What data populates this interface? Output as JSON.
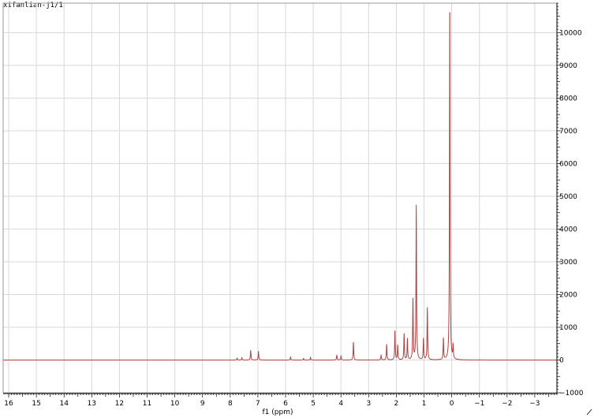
{
  "chart_data": {
    "type": "line",
    "title": "xifanlian-j1/1",
    "xlabel": "f1 (ppm)",
    "ylabel": "",
    "x_reversed": true,
    "xlim": [
      16.2,
      -3.8
    ],
    "ylim": [
      -1000,
      10900
    ],
    "x_ticks": [
      16,
      15,
      14,
      13,
      12,
      11,
      10,
      9,
      8,
      7,
      6,
      5,
      4,
      3,
      2,
      1,
      0,
      -1,
      -2,
      -3
    ],
    "y_ticks": [
      -1000,
      0,
      1000,
      2000,
      3000,
      4000,
      5000,
      6000,
      7000,
      8000,
      9000,
      10000
    ],
    "grid": true,
    "line_color": "#b04040",
    "grid_color": "#d8d8d8",
    "series": [
      {
        "baseline": 0,
        "peaks": [
          {
            "ppm": 7.75,
            "height": 60
          },
          {
            "ppm": 7.58,
            "height": 70
          },
          {
            "ppm": 7.26,
            "height": 300
          },
          {
            "ppm": 6.98,
            "height": 270
          },
          {
            "ppm": 5.82,
            "height": 90
          },
          {
            "ppm": 5.35,
            "height": 50
          },
          {
            "ppm": 5.1,
            "height": 80
          },
          {
            "ppm": 4.15,
            "height": 150
          },
          {
            "ppm": 4.0,
            "height": 120
          },
          {
            "ppm": 3.55,
            "height": 550
          },
          {
            "ppm": 2.55,
            "height": 150
          },
          {
            "ppm": 2.35,
            "height": 480
          },
          {
            "ppm": 2.05,
            "height": 900
          },
          {
            "ppm": 1.95,
            "height": 450
          },
          {
            "ppm": 1.72,
            "height": 800
          },
          {
            "ppm": 1.6,
            "height": 650
          },
          {
            "ppm": 1.4,
            "height": 1850
          },
          {
            "ppm": 1.28,
            "height": 4720
          },
          {
            "ppm": 1.02,
            "height": 650
          },
          {
            "ppm": 0.88,
            "height": 1600
          },
          {
            "ppm": 0.3,
            "height": 650
          },
          {
            "ppm": 0.07,
            "height": 10900
          },
          {
            "ppm": -0.05,
            "height": 400
          }
        ]
      }
    ]
  }
}
